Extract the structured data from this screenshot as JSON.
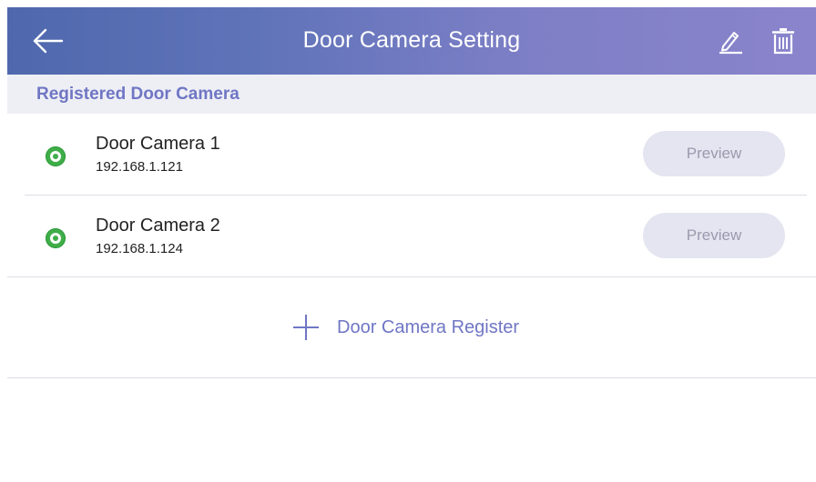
{
  "header": {
    "title": "Door Camera Setting",
    "back_icon": "arrow-left-icon",
    "edit_icon": "pencil-icon",
    "delete_icon": "trash-icon"
  },
  "section": {
    "title": "Registered Door Camera"
  },
  "cameras": [
    {
      "name": "Door Camera 1",
      "ip": "192.168.1.121",
      "status_icon": "online-status-icon",
      "status_color": "#3fae49",
      "preview_label": "Preview"
    },
    {
      "name": "Door Camera 2",
      "ip": "192.168.1.124",
      "status_icon": "online-status-icon",
      "status_color": "#3fae49",
      "preview_label": "Preview"
    }
  ],
  "register": {
    "label": "Door Camera Register",
    "icon": "plus-icon"
  },
  "colors": {
    "accent": "#6f76c4",
    "header_gradient_start": "#4f68ad",
    "header_gradient_end": "#8a84cc",
    "button_bg": "#e4e5f0"
  }
}
